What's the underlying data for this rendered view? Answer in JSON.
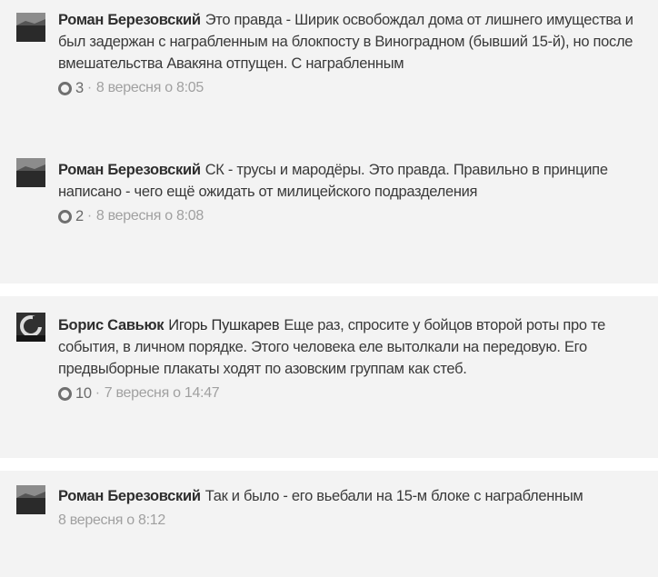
{
  "comments": [
    {
      "author": "Роман Березовский",
      "mention": "",
      "text": "Это правда - Ширик освобождал дома от лишнего имущества и был задержан с награбленным на блокпосту в Виноградном (бывший 15-й), но после вмешательства Авакяна отпущен. С награбленным",
      "likes": "3",
      "separator": "·",
      "timestamp": "8 вересня о 8:05",
      "avatar_icon": "profile-picture-dark"
    },
    {
      "author": "Роман Березовский",
      "mention": "",
      "text": "СК - трусы и мародёры. Это правда. Правильно в принципе написано - чего ещё ожидать от милицейского подразделения",
      "likes": "2",
      "separator": "·",
      "timestamp": "8 вересня о 8:08",
      "avatar_icon": "profile-picture-dark"
    },
    {
      "author": "Борис Савьюк",
      "mention": "Игорь Пушкарев",
      "text": "Еще раз, спросите у бойцов второй роты про те события, в личном порядке. Этого человека еле вытолкали на передовую. Его предвыборные плакаты ходят по азовским группам как стеб.",
      "likes": "10",
      "separator": "·",
      "timestamp": "7 вересня о 14:47",
      "avatar_icon": "profile-picture-circle"
    },
    {
      "author": "Роман Березовский",
      "mention": "",
      "text": "Так и было - его вьебали на 15-м блоке с награбленным",
      "likes": "",
      "separator": "",
      "timestamp": "8 вересня о 8:12",
      "avatar_icon": "profile-picture-dark"
    }
  ]
}
